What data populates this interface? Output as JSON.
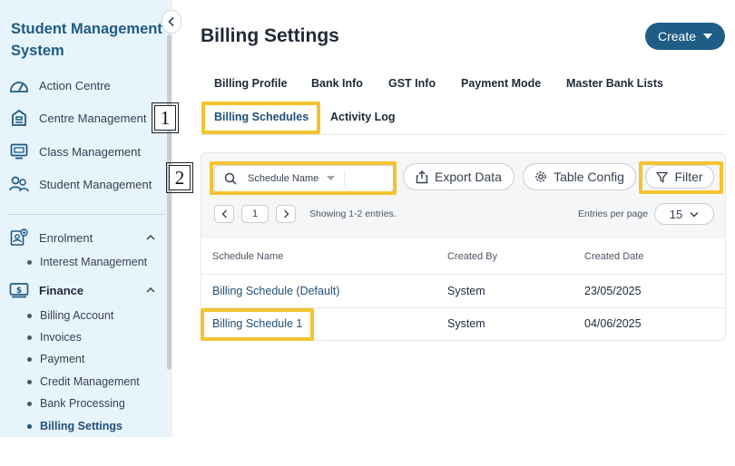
{
  "sidebar": {
    "app_title": "Student Management System",
    "items": [
      {
        "label": "Action Centre",
        "icon": "speedometer-icon"
      },
      {
        "label": "Centre Management",
        "icon": "building-icon"
      },
      {
        "label": "Class Management",
        "icon": "classroom-icon"
      },
      {
        "label": "Student Management",
        "icon": "users-icon"
      }
    ],
    "groups": [
      {
        "label": "Enrolment",
        "icon": "enrolment-icon",
        "expanded": true,
        "sub_items": [
          "Interest Management"
        ]
      },
      {
        "label": "Finance",
        "icon": "finance-icon",
        "expanded": true,
        "sub_items": [
          "Billing Account",
          "Invoices",
          "Payment",
          "Credit Management",
          "Bank Processing",
          "Billing Settings"
        ],
        "active_sub_item": "Billing Settings"
      }
    ]
  },
  "callouts": [
    "1",
    "2"
  ],
  "header": {
    "title": "Billing Settings",
    "create_label": "Create"
  },
  "tabs": [
    {
      "label": "Billing Profile"
    },
    {
      "label": "Bank Info"
    },
    {
      "label": "GST Info"
    },
    {
      "label": "Payment Mode"
    },
    {
      "label": "Master Bank Lists"
    },
    {
      "label": "Billing Schedules",
      "active": true
    },
    {
      "label": "Activity Log"
    }
  ],
  "toolbar": {
    "search_field": "Schedule Name",
    "export_label": "Export Data",
    "table_config_label": "Table Config",
    "filter_label": "Filter",
    "page_number": "1",
    "showing_text": "Showing 1-2 entries.",
    "entries_label": "Entries per page",
    "entries_value": "15"
  },
  "table": {
    "columns": [
      "Schedule Name",
      "Created By",
      "Created Date"
    ],
    "rows": [
      {
        "name": "Billing Schedule (Default)",
        "created_by": "System",
        "created_date": "23/05/2025"
      },
      {
        "name": "Billing Schedule 1",
        "created_by": "System",
        "created_date": "04/06/2025"
      }
    ]
  },
  "colors": {
    "brand": "#1f5d87",
    "highlight": "#f4c430",
    "sidebar_bg": "#e8f4fc"
  }
}
